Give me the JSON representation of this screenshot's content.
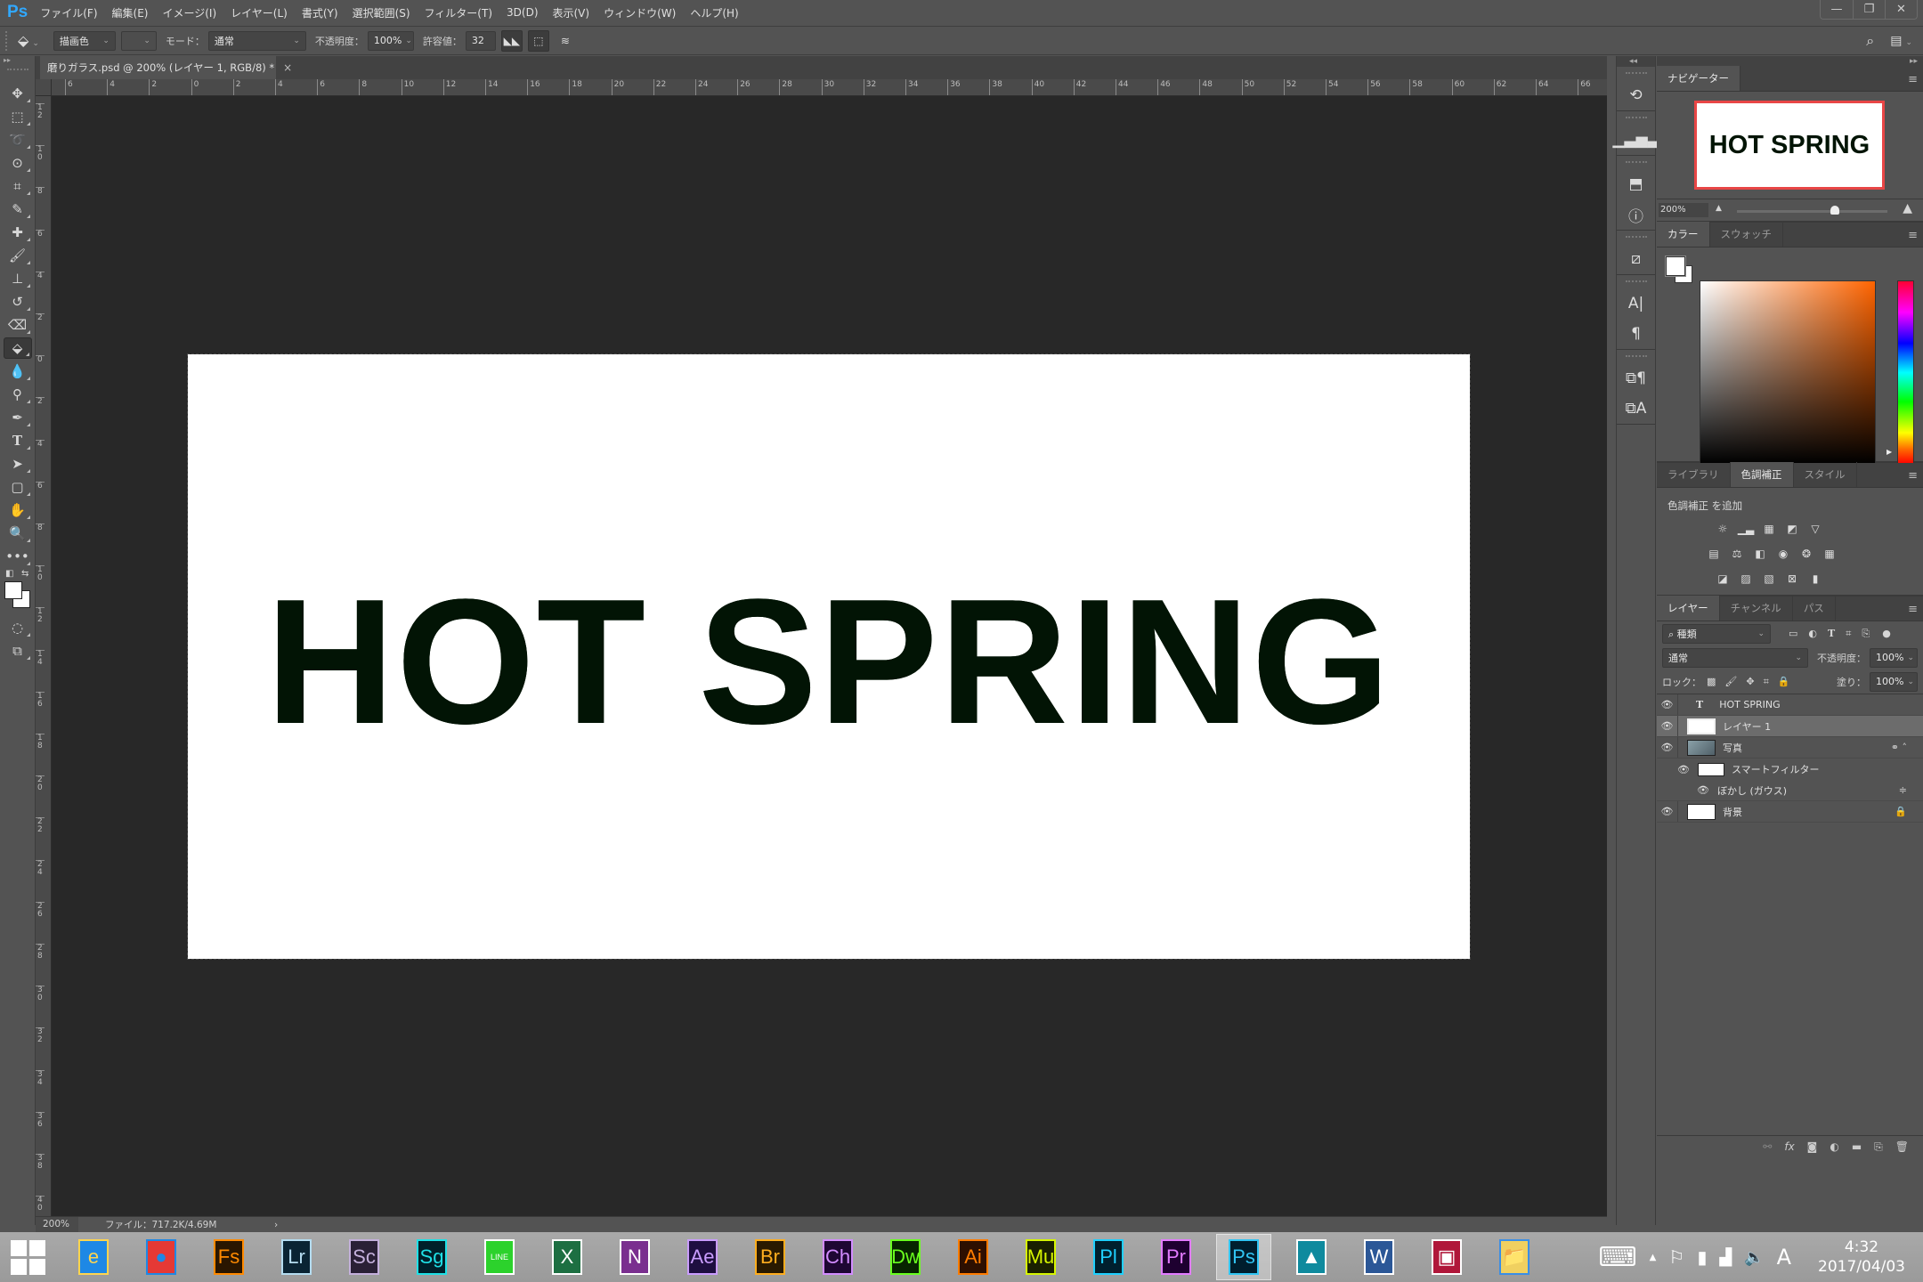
{
  "app": {
    "logo": "Ps",
    "name": "Photoshop"
  },
  "menu": [
    "ファイル(F)",
    "編集(E)",
    "イメージ(I)",
    "レイヤー(L)",
    "書式(Y)",
    "選択範囲(S)",
    "フィルター(T)",
    "3D(D)",
    "表示(V)",
    "ウィンドウ(W)",
    "ヘルプ(H)"
  ],
  "window_controls": {
    "minimize": "—",
    "restore": "❐",
    "close": "✕"
  },
  "options_bar": {
    "tool_icon": "paint-bucket-icon",
    "fill_source": "描画色",
    "mode_label": "モード：",
    "mode_value": "通常",
    "opacity_label": "不透明度：",
    "opacity_value": "100%",
    "tolerance_label": "許容値：",
    "tolerance_value": "32"
  },
  "document_tab": {
    "title": "磨りガラス.psd @ 200% (レイヤー 1, RGB/8) *",
    "close": "×"
  },
  "rulers": {
    "horizontal": [
      "6",
      "4",
      "2",
      "0",
      "2",
      "4",
      "6",
      "8",
      "10",
      "12",
      "14",
      "16",
      "18",
      "20",
      "22",
      "24",
      "26",
      "28",
      "30",
      "32",
      "34",
      "36",
      "38",
      "40",
      "42",
      "44",
      "46",
      "48",
      "50",
      "52",
      "54",
      "56",
      "58",
      "60",
      "62",
      "64",
      "66"
    ],
    "vertical": [
      "12",
      "10",
      "8",
      "6",
      "4",
      "2",
      "0",
      "2",
      "4",
      "6",
      "8",
      "10",
      "12",
      "14",
      "16",
      "18",
      "20",
      "22",
      "24",
      "26",
      "28",
      "30",
      "32",
      "34",
      "36",
      "38",
      "40"
    ]
  },
  "canvas": {
    "text": "HOT SPRING",
    "text_color": "#021405"
  },
  "status_bar": {
    "zoom": "200%",
    "file_info": "ファイル：717.2K/4.69M",
    "arrow": "›"
  },
  "tools": [
    "move",
    "marquee",
    "lasso",
    "quick-select",
    "crop",
    "eyedropper",
    "healing",
    "brush",
    "stamp",
    "history-brush",
    "eraser",
    "paint-bucket",
    "blur",
    "dodge",
    "pen",
    "type",
    "path-select",
    "shape",
    "hand",
    "zoom",
    "more"
  ],
  "navigator": {
    "tab": "ナビゲーター",
    "thumb_text": "HOT SPRING",
    "zoom": "200%",
    "zoom_slider_fraction": 0.65
  },
  "color_panel": {
    "tabs": [
      "カラー",
      "スウォッチ"
    ],
    "foreground": "#ffffff",
    "background": "#ffffff",
    "hue_color": "#ff6400"
  },
  "adjustments": {
    "tabs": [
      "ライブラリ",
      "色調補正",
      "スタイル"
    ],
    "active_tab": 1,
    "title": "色調補正 を追加"
  },
  "layers_panel": {
    "tabs": [
      "レイヤー",
      "チャンネル",
      "パス"
    ],
    "filter_label": "種類",
    "blend_mode": "通常",
    "opacity_label": "不透明度：",
    "opacity_value": "100%",
    "lock_label": "ロック：",
    "fill_label": "塗り：",
    "fill_value": "100%",
    "layers": [
      {
        "name": "HOT SPRING",
        "type": "text"
      },
      {
        "name": "レイヤー 1",
        "type": "pixel",
        "selected": true
      },
      {
        "name": "写真",
        "type": "smart-object"
      },
      {
        "name": "スマートフィルター",
        "type": "smart-filter"
      },
      {
        "name": "ぼかし (ガウス)",
        "type": "filter"
      },
      {
        "name": "背景",
        "type": "background",
        "locked": true
      }
    ]
  },
  "taskbar": {
    "apps": [
      {
        "name": "Internet Explorer",
        "label": "e",
        "bg": "#1e88e5",
        "fg": "#ffd54f"
      },
      {
        "name": "Chrome",
        "label": "●",
        "bg": "#e53935",
        "fg": "#1e88e5"
      },
      {
        "name": "Fuse",
        "label": "Fs",
        "bg": "#2a1600",
        "fg": "#ff8a00"
      },
      {
        "name": "Lightroom",
        "label": "Lr",
        "bg": "#0a2433",
        "fg": "#b4dcf0"
      },
      {
        "name": "Scout",
        "label": "Sc",
        "bg": "#2a2036",
        "fg": "#c4b0dc"
      },
      {
        "name": "Speedgrade",
        "label": "Sg",
        "bg": "#00202a",
        "fg": "#1fe0e6"
      },
      {
        "name": "LINE",
        "label": "LINE",
        "bg": "#2cd22c",
        "fg": "#ffffff"
      },
      {
        "name": "Excel",
        "label": "X",
        "bg": "#1d6f42",
        "fg": "#ffffff"
      },
      {
        "name": "OneNote",
        "label": "N",
        "bg": "#7a2f8f",
        "fg": "#ffffff"
      },
      {
        "name": "After Effects",
        "label": "Ae",
        "bg": "#1e0e40",
        "fg": "#c99cff"
      },
      {
        "name": "Bridge",
        "label": "Br",
        "bg": "#2a1a00",
        "fg": "#ffae1f"
      },
      {
        "name": "Character Animator",
        "label": "Ch",
        "bg": "#1e0733",
        "fg": "#d28cff"
      },
      {
        "name": "Dreamweaver",
        "label": "Dw",
        "bg": "#072400",
        "fg": "#6aff1f"
      },
      {
        "name": "Illustrator",
        "label": "Ai",
        "bg": "#2e0f00",
        "fg": "#ff7c00"
      },
      {
        "name": "Muse",
        "label": "Mu",
        "bg": "#1a2000",
        "fg": "#d6f500"
      },
      {
        "name": "Prelude",
        "label": "Pl",
        "bg": "#00202e",
        "fg": "#1fd0ff"
      },
      {
        "name": "Premiere Pro",
        "label": "Pr",
        "bg": "#1e0030",
        "fg": "#e27bff"
      },
      {
        "name": "Photoshop",
        "label": "Ps",
        "bg": "#001e2e",
        "fg": "#31c5f4",
        "active": true
      },
      {
        "name": "Photos",
        "label": "▲",
        "bg": "#0f8a9e",
        "fg": "#ffffff"
      },
      {
        "name": "Word",
        "label": "W",
        "bg": "#2b5797",
        "fg": "#ffffff"
      },
      {
        "name": "Remote Desktop",
        "label": "▣",
        "bg": "#b0173a",
        "fg": "#ffffff"
      },
      {
        "name": "File Explorer",
        "label": "📁",
        "bg": "#f0d060",
        "fg": "#3a8ee6"
      }
    ],
    "tray": {
      "keyboard": "⌨",
      "up_arrow": "▲",
      "flag": "⚐",
      "power": "▮",
      "network": "▟",
      "volume": "🔈",
      "ime": "A"
    },
    "clock": {
      "time": "4:32",
      "date": "2017/04/03"
    }
  }
}
